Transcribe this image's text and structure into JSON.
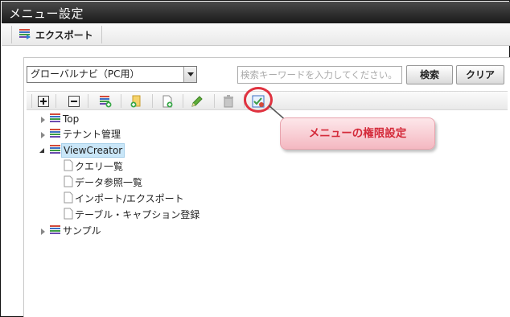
{
  "window": {
    "title": "メニュー設定"
  },
  "top_toolbar": {
    "export_label": "エクスポート",
    "export_icon": "export-icon"
  },
  "menu_select": {
    "selected": "グローバルナビ（PC用）"
  },
  "search": {
    "placeholder": "検索キーワードを入力してください。",
    "search_label": "検索",
    "clear_label": "クリア"
  },
  "icon_bar": [
    {
      "name": "add-icon"
    },
    {
      "name": "remove-icon"
    },
    {
      "name": "menu-add-icon"
    },
    {
      "name": "folder-add-icon"
    },
    {
      "name": "page-add-icon"
    },
    {
      "name": "edit-pencil-icon"
    },
    {
      "name": "trash-icon"
    },
    {
      "name": "menu-permission-icon"
    }
  ],
  "tree": {
    "nodes": [
      {
        "label": "Top",
        "state": "closed",
        "type": "menu"
      },
      {
        "label": "テナント管理",
        "state": "closed",
        "type": "menu"
      },
      {
        "label": "ViewCreator",
        "state": "open",
        "type": "menu",
        "selected": true
      },
      {
        "label": "クエリ一覧",
        "type": "page"
      },
      {
        "label": "データ参照一覧",
        "type": "page"
      },
      {
        "label": "インポート/エクスポート",
        "type": "page"
      },
      {
        "label": "テーブル・キャプション登録",
        "type": "page"
      },
      {
        "label": "サンプル",
        "state": "closed",
        "type": "menu"
      }
    ]
  },
  "callout": {
    "text": "メニューの権限設定"
  },
  "colors": {
    "accent_red": "#e0323f",
    "selection": "#c9e6f8",
    "title_bg": "#2a2a2a"
  }
}
